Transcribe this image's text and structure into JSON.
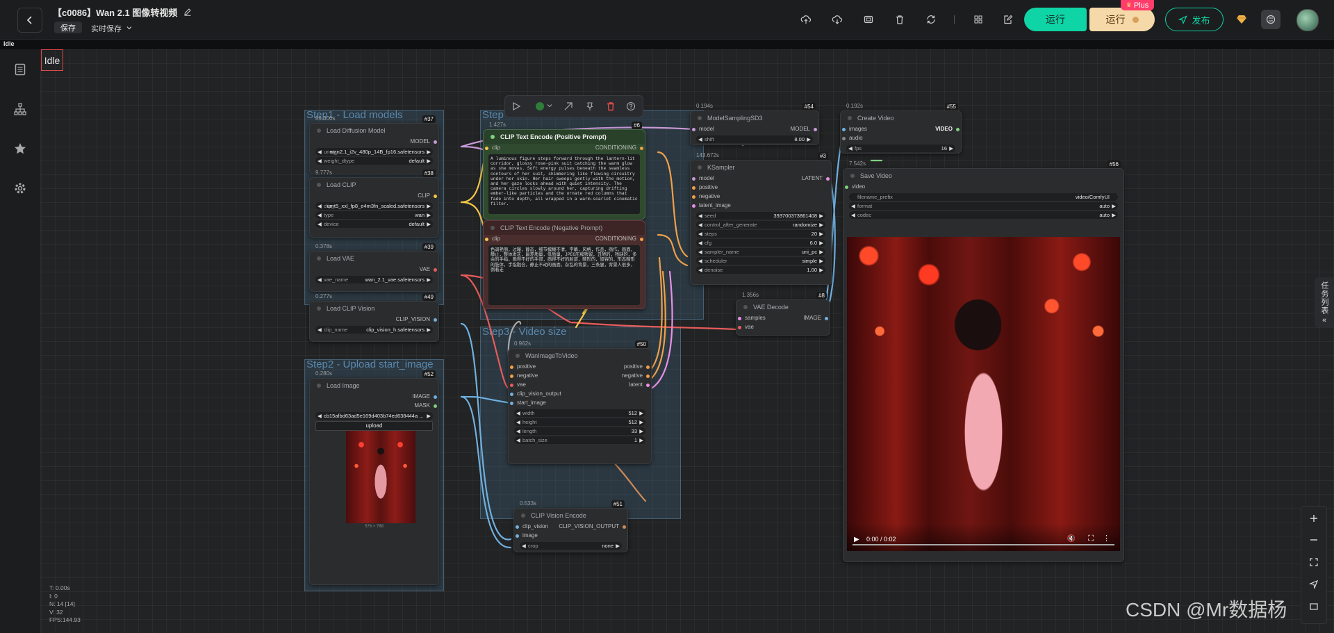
{
  "app": {
    "title": "【c0086】Wan 2.1 图像转视频",
    "save_label": "保存",
    "autosave_label": "实时保存",
    "run_primary": "运行",
    "run_secondary": "运行",
    "plus_badge": "Plus",
    "publish": "发布",
    "subbar_status": "Idle",
    "accent_color": "#0fd4a5"
  },
  "canvas": {
    "status": "Idle",
    "task_list_label": "任务列表",
    "watermark": "CSDN @Mr数据杨",
    "stats": [
      "T: 0.00s",
      "I: 0",
      "N: 14 [14]",
      "V: 32",
      "FPS:144.93"
    ]
  },
  "groups": {
    "step1": "Step1 - Load models",
    "step2": "Step2 - Upload start_image",
    "step3": "Step3 - Video size",
    "step4": "Step"
  },
  "nodes": {
    "diffusion": {
      "time": "89.300s",
      "id": "#37",
      "title": "Load Diffusion Model",
      "out": "MODEL",
      "unet_label": "unet_",
      "unet_value": "wan2.1_i2v_480p_14B_fp16.safetensors",
      "dtype_label": "weight_dtype",
      "dtype_value": "default"
    },
    "clip": {
      "time": "9.777s",
      "id": "#38",
      "title": "Load CLIP",
      "out": "CLIP",
      "clip_label": "clip_",
      "clip_value": "umt5_xxl_fp8_e4m3fn_scaled.safetensors",
      "type_label": "type",
      "type_value": "wan",
      "device_label": "device",
      "device_value": "default"
    },
    "vae": {
      "time": "0.378s",
      "id": "#39",
      "title": "Load VAE",
      "out": "VAE",
      "name_label": "vae_name",
      "name_value": "wan_2.1_vae.safetensors"
    },
    "clipvision": {
      "time": "0.277s",
      "id": "#49",
      "title": "Load CLIP Vision",
      "out": "CLIP_VISION",
      "name_label": "clip_name",
      "name_value": "clip_vision_h.safetensors"
    },
    "loadimage": {
      "time": "0.280s",
      "id": "#52",
      "title": "Load Image",
      "out1": "IMAGE",
      "out2": "MASK",
      "image_value": "cb15afbd63ad5e169d403b74ed638444a ...",
      "upload": "upload",
      "dims": "576 × 768"
    },
    "pos": {
      "time": "1.427s",
      "id": "#6",
      "title": "CLIP Text Encode (Positive Prompt)",
      "in": "clip",
      "out": "CONDITIONING",
      "text": "A luminous figure steps forward through the lantern-lit corridor, glossy rose-pink suit catching the warm glow as she moves. Soft energy pulses beneath the seamless contours of her suit, shimmering like flowing circuitry under her skin. Her hair sweeps gently with the motion, and her gaze locks ahead with quiet intensity. The camera circles slowly around her, capturing drifting ember-like particles and the ornate red columns that fade into depth, all wrapped in a warm-scarlet cinematic filter."
    },
    "neg": {
      "title": "CLIP Text Encode (Negative Prompt)",
      "in": "clip",
      "out": "CONDITIONING",
      "text": "色调艳丽，过曝，静态，细节模糊不清，字幕，风格，作品，画作，画面，静止，整体发灰，最差质量，低质量，JPEG压缩残留，丑陋的，残缺的，多余的手指，画得不好的手部，画得不好的脸部，畸形的，毁容的，形态畸形的肢体，手指融合，静止不动的画面，杂乱的背景，三条腿，背景人很多，倒着走"
    },
    "msd3": {
      "time": "0.194s",
      "id": "#54",
      "title": "ModelSamplingSD3",
      "in": "model",
      "out": "MODEL",
      "shift_label": "shift",
      "shift_value": "8.00"
    },
    "ksampler": {
      "time": "143.672s",
      "id": "#3",
      "title": "KSampler",
      "in1": "model",
      "in2": "positive",
      "in3": "negative",
      "in4": "latent_image",
      "out": "LATENT",
      "widgets": [
        {
          "label": "seed",
          "value": "393700373861408"
        },
        {
          "label": "control_after_generate",
          "value": "randomize"
        },
        {
          "label": "steps",
          "value": "20"
        },
        {
          "label": "cfg",
          "value": "6.0"
        },
        {
          "label": "sampler_name",
          "value": "uni_pc"
        },
        {
          "label": "scheduler",
          "value": "simple"
        },
        {
          "label": "denoise",
          "value": "1.00"
        }
      ]
    },
    "vaedecode": {
      "time": "1.356s",
      "id": "#8",
      "title": "VAE Decode",
      "in1": "samples",
      "in2": "vae",
      "out": "IMAGE"
    },
    "createvideo": {
      "time": "0.192s",
      "id": "#55",
      "title": "Create Video",
      "in1": "images",
      "in2": "audio",
      "out": "VIDEO",
      "fps_label": "fps",
      "fps_value": "16"
    },
    "savevideo": {
      "time": "7.542s",
      "id": "#56",
      "title": "Save Video",
      "in": "video",
      "prefix_label": "filename_prefix",
      "prefix_value": "video/ComfyUI",
      "format_label": "format",
      "format_value": "auto",
      "codec_label": "codec",
      "codec_value": "auto",
      "time_display": "0:00 / 0:02"
    },
    "wan": {
      "time": "0.962s",
      "id": "#50",
      "title": "WanImageToVideo",
      "in1": "positive",
      "in2": "negative",
      "in3": "vae",
      "in4": "clip_vision_output",
      "in5": "start_image",
      "out1": "positive",
      "out2": "negative",
      "out3": "latent",
      "widgets": [
        {
          "label": "width",
          "value": "512"
        },
        {
          "label": "height",
          "value": "512"
        },
        {
          "label": "length",
          "value": "33"
        },
        {
          "label": "batch_size",
          "value": "1"
        }
      ]
    },
    "clipvisionencode": {
      "time": "0.533s",
      "id": "#51",
      "title": "CLIP Vision Encode",
      "in1": "clip_vision",
      "in2": "image",
      "out": "CLIP_VISION_OUTPUT",
      "crop_label": "crop",
      "crop_value": "none"
    }
  }
}
